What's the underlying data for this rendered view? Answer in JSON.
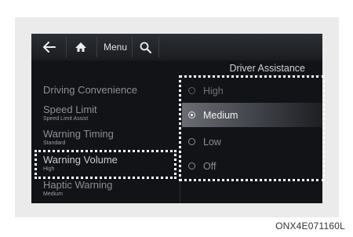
{
  "topbar": {
    "back_icon": "back-arrow-icon",
    "home_icon": "home-icon",
    "menu_label": "Menu",
    "search_icon": "search-icon"
  },
  "section_title": "Driver Assistance",
  "settings": [
    {
      "label": "Driving Convenience",
      "sub": ""
    },
    {
      "label": "Speed Limit",
      "sub": "Speed Limit Assist"
    },
    {
      "label": "Warning Timing",
      "sub": "Standard"
    },
    {
      "label": "Warning Volume",
      "sub": "High"
    },
    {
      "label": "Haptic Warning",
      "sub": "Medium"
    }
  ],
  "options": [
    {
      "label": "High",
      "selected": false
    },
    {
      "label": "Medium",
      "selected": true
    },
    {
      "label": "Low",
      "selected": false
    },
    {
      "label": "Off",
      "selected": false
    }
  ],
  "caption": "ONX4E071160L",
  "colors": {
    "screen_bg": "#111317",
    "highlight": "#ffffff",
    "panel_bg": "#ebebeb"
  }
}
